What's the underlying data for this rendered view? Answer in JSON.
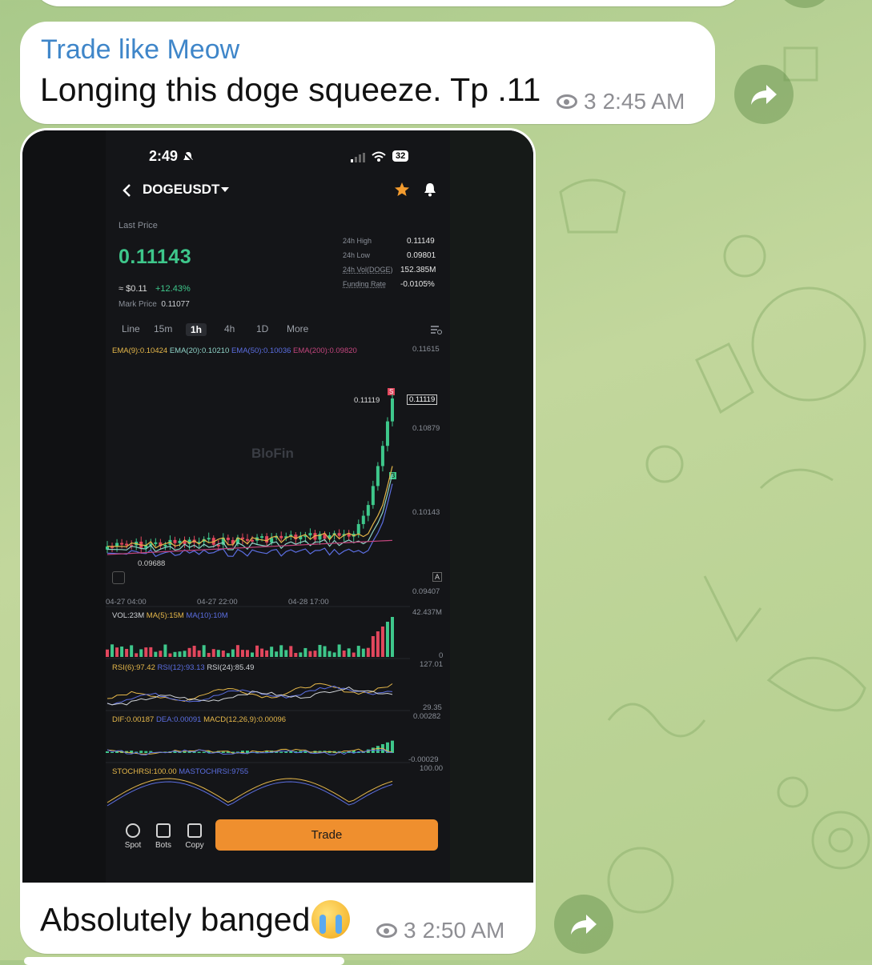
{
  "messages": [
    {
      "sender": "Trade like Meow",
      "text": "Longing this doge squeeze. Tp .11",
      "views": "3",
      "time": "2:45 AM"
    },
    {
      "caption": "Absolutely banged",
      "emoji": "crying-face",
      "views": "3",
      "time": "2:50 AM"
    }
  ],
  "screenshot": {
    "status_time": "2:49",
    "battery": "32",
    "pair": "DOGEUSDT",
    "last_price_label": "Last Price",
    "last_price": "0.11143",
    "usd_price": "≈ $0.11",
    "change_pct": "+12.43%",
    "mark_price_label": "Mark Price",
    "mark_price": "0.11077",
    "stats": [
      {
        "label": "24h High",
        "value": "0.11149"
      },
      {
        "label": "24h Low",
        "value": "0.09801"
      },
      {
        "label": "24h Vol(DOGE)",
        "value": "152.385M"
      },
      {
        "label": "Funding Rate",
        "value": "-0.0105%"
      }
    ],
    "timeframes": [
      "Line",
      "15m",
      "1h",
      "4h",
      "1D",
      "More"
    ],
    "active_timeframe": "1h",
    "ema_legend": [
      {
        "text": "EMA(9):0.10424",
        "color": "#e6b84a"
      },
      {
        "text": "EMA(20):0.10210",
        "color": "#8fd3c7"
      },
      {
        "text": "EMA(50):0.10036",
        "color": "#5b6ee1"
      },
      {
        "text": "EMA(200):0.09820",
        "color": "#c3457d"
      }
    ],
    "price_axis": [
      "0.11615",
      "0.10879",
      "0.10143",
      "0.09407"
    ],
    "current_price_tag": "0.11119",
    "last_candle_label": "0.11119",
    "low_label": "0.09688",
    "watermark": "BloFin",
    "time_axis": [
      "04-27 04:00",
      "04-27 22:00",
      "04-28 17:00"
    ],
    "vol_legend": [
      {
        "text": "VOL:23M",
        "color": "#cfd2d6"
      },
      {
        "text": "MA(5):15M",
        "color": "#e6b84a"
      },
      {
        "text": "MA(10):10M",
        "color": "#5b6ee1"
      }
    ],
    "vol_axis": [
      "42.437M",
      "0"
    ],
    "rsi_legend": [
      {
        "text": "RSI(6):97.42",
        "color": "#e6b84a"
      },
      {
        "text": "RSI(12):93.13",
        "color": "#5b6ee1"
      },
      {
        "text": "RSI(24):85.49",
        "color": "#cfd2d6"
      }
    ],
    "rsi_axis": [
      "127.01",
      "29.35"
    ],
    "macd_legend": [
      {
        "text": "DIF:0.00187",
        "color": "#e6b84a"
      },
      {
        "text": "DEA:0.00091",
        "color": "#5b6ee1"
      },
      {
        "text": "MACD(12,26,9):0.00096",
        "color": "#e6b84a"
      }
    ],
    "macd_axis": [
      "0.00282",
      "-0.00029"
    ],
    "stoch_legend": [
      {
        "text": "STOCHRSI:100.00",
        "color": "#e6b84a"
      },
      {
        "text": "MASTOCHRSI:9755",
        "color": "#5b6ee1"
      }
    ],
    "stoch_axis": [
      "100.00"
    ],
    "bottom_nav": [
      "Spot",
      "Bots",
      "Copy"
    ],
    "trade_button": "Trade",
    "colors": {
      "up": "#3ec78b",
      "down": "#e2475d",
      "accent": "#ef8f2e"
    }
  }
}
